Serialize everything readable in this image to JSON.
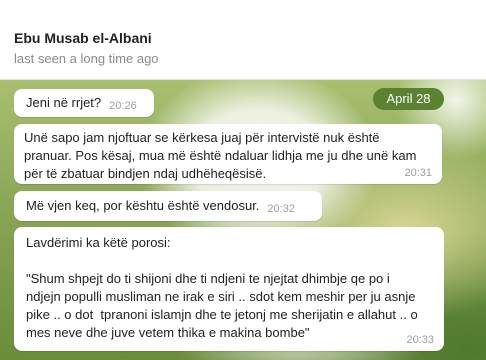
{
  "header": {
    "contact_name": "Ebu Musab el-Albani",
    "status": "last seen a long time ago"
  },
  "chat": {
    "date_badge": "April 28",
    "messages": [
      {
        "text": "Jeni në rrjet?",
        "time": "20:26"
      },
      {
        "text": "Unë sapo jam njoftuar se kërkesa juaj për intervistë nuk është\npranuar. Pos kësaj, mua më është ndaluar lidhja me ju dhe unë kam\npër të zbatuar bindjen ndaj udhëheqësisë.",
        "time": "20:31"
      },
      {
        "text": "Më vjen keq, por kështu është vendosur.",
        "time": "20:32"
      },
      {
        "text": "Lavdërimi ka këtë porosi:\n\n\"Shum shpejt do ti shijoni dhe ti ndjeni te njejtat dhimbje qe po i\nndjejn populli musliman ne irak e siri .. sdot kem meshir per ju asnje\npike .. o dot  tpranoni islamjn dhe te jetonj me sherijatin e allahut .. o\nmes neve dhe juve vetem thika e makina bombe\"",
        "time": "20:33"
      }
    ]
  },
  "colors": {
    "date_badge_bg": "#5a8231",
    "bubble_bg": "#ffffff",
    "time_text": "#9aa0a6"
  }
}
